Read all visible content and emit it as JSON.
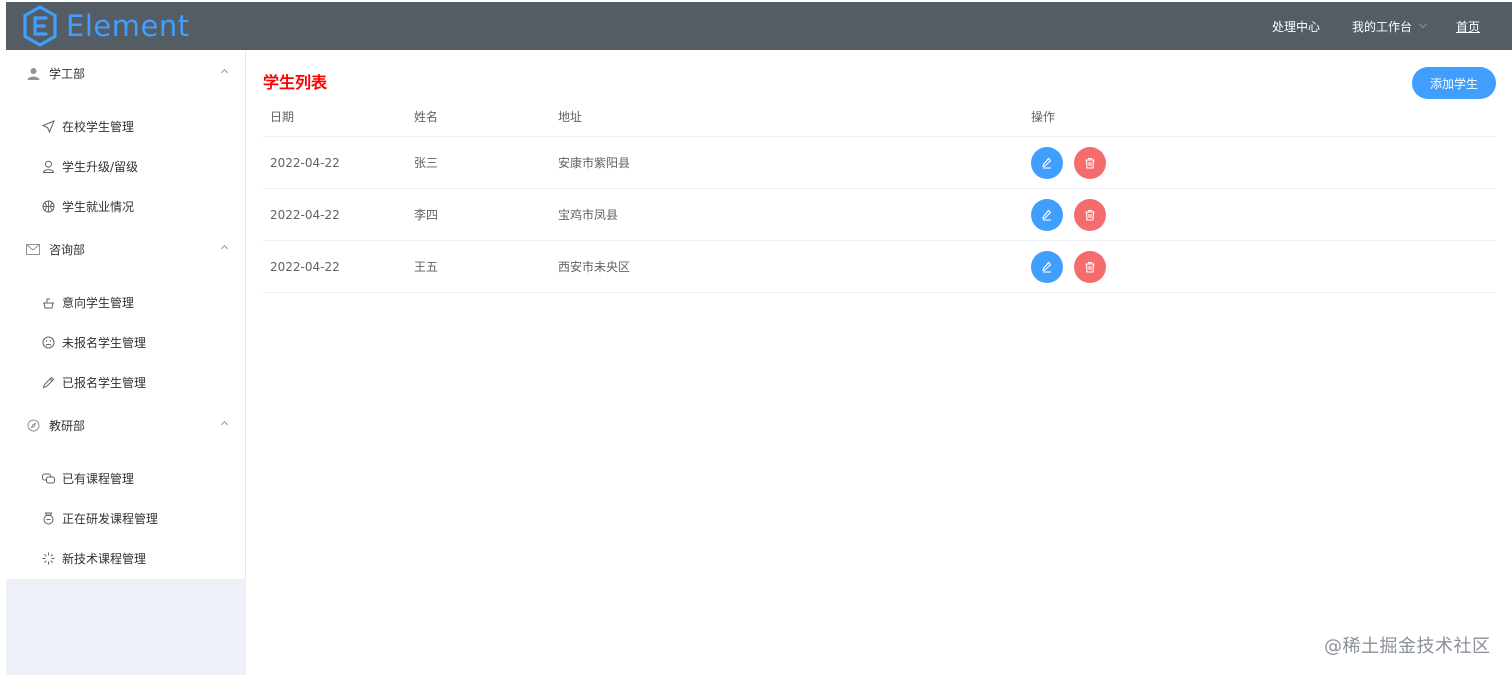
{
  "header": {
    "logo_text": "Element",
    "nav": {
      "processing_center": "处理中心",
      "my_workspace": "我的工作台",
      "home": "首页"
    }
  },
  "sidebar": {
    "groups": [
      {
        "title": "学工部",
        "icon": "user-icon",
        "items": [
          {
            "label": "在校学生管理",
            "icon": "position-icon"
          },
          {
            "label": "学生升级/留级",
            "icon": "user-outline-icon"
          },
          {
            "label": "学生就业情况",
            "icon": "basketball-icon"
          }
        ]
      },
      {
        "title": "咨询部",
        "icon": "message-icon",
        "items": [
          {
            "label": "意向学生管理",
            "icon": "cold-drink-icon"
          },
          {
            "label": "未报名学生管理",
            "icon": "sad-face-icon"
          },
          {
            "label": "已报名学生管理",
            "icon": "pen-icon"
          }
        ]
      },
      {
        "title": "教研部",
        "icon": "compass-icon",
        "items": [
          {
            "label": "已有课程管理",
            "icon": "chat-icon"
          },
          {
            "label": "正在研发课程管理",
            "icon": "medal-icon"
          },
          {
            "label": "新技术课程管理",
            "icon": "loading-icon"
          }
        ]
      }
    ]
  },
  "main": {
    "title": "学生列表",
    "add_button": "添加学生",
    "table": {
      "columns": [
        "日期",
        "姓名",
        "地址",
        "操作"
      ],
      "rows": [
        {
          "date": "2022-04-22",
          "name": "张三",
          "address": "安康市紫阳县"
        },
        {
          "date": "2022-04-22",
          "name": "李四",
          "address": "宝鸡市凤县"
        },
        {
          "date": "2022-04-22",
          "name": "王五",
          "address": "西安市未央区"
        }
      ]
    }
  },
  "watermark": "@稀土掘金技术社区",
  "colors": {
    "header_bg": "#545c64",
    "primary": "#409eff",
    "danger": "#f56c6c",
    "title_red": "#ff0000",
    "sidebar_bottom": "#edf0f6"
  }
}
